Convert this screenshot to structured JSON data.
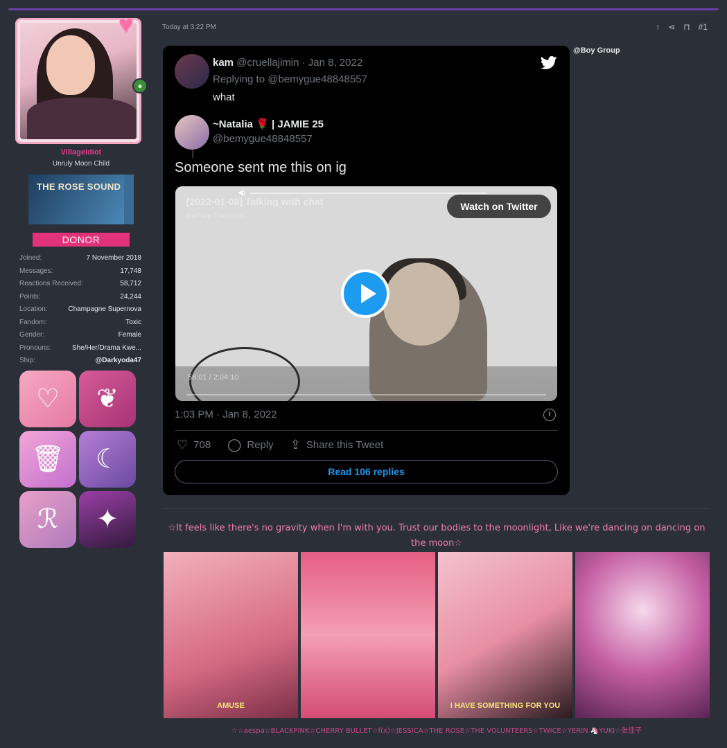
{
  "user": {
    "username": "VillageIdiot",
    "title": "Unruly Moon Child",
    "banner_text": "THE ROSE SOUND",
    "donor_label": "DONOR",
    "stats": [
      {
        "label": "Joined:",
        "value": "7 November 2018"
      },
      {
        "label": "Messages:",
        "value": "17,748"
      },
      {
        "label": "Reactions Received:",
        "value": "58,712"
      },
      {
        "label": "Points:",
        "value": "24,244"
      },
      {
        "label": "Location:",
        "value": "Champagne Supernova"
      },
      {
        "label": "Fandom:",
        "value": "Toxic"
      },
      {
        "label": "Gender:",
        "value": "Female"
      },
      {
        "label": "Pronouns:",
        "value": "She/Her/Drama Kwe..."
      },
      {
        "label": "Ship:",
        "value": "@Darkyoda47"
      }
    ]
  },
  "post": {
    "timestamp": "Today at 3:22 PM",
    "number": "#1",
    "mention": "@Boy Group",
    "lyric": "☆It feels like there's no gravity when I'm with you. Trust our bodies to the moonlight, Like we're dancing on dancing on the moon☆",
    "photo_captions": [
      "AMUSE",
      "",
      "I HAVE SOMETHING FOR YOU",
      ""
    ],
    "footer": "☆☆aespa☆BLACKPINK☆CHERRY BULLET☆f(x)☆JESSICA☆THE ROSE☆THE VOLUNTEERS☆TWICE☆YERIN 🦄YUKI☆张佳子"
  },
  "tweet": {
    "reply_name": "kam",
    "reply_handle_date": "@cruellajimin · Jan 8, 2022",
    "replying_to": "Replying to @bemygue48848557",
    "reply_text": "what",
    "main_name": "~Natalia 🌹 | JAMIE 25",
    "main_handle": "@bemygue48848557",
    "text": "Someone sent me this on ig",
    "video_title": "[2022-01-08] Talking with chat",
    "video_subtitle": "ExtPara Transcript...",
    "video_time": "58:01 / 2:04:10",
    "watch_label": "Watch on Twitter",
    "date": "1:03 PM · Jan 8, 2022",
    "likes": "708",
    "reply_label": "Reply",
    "share_label": "Share this Tweet",
    "read_replies": "Read 106 replies"
  }
}
